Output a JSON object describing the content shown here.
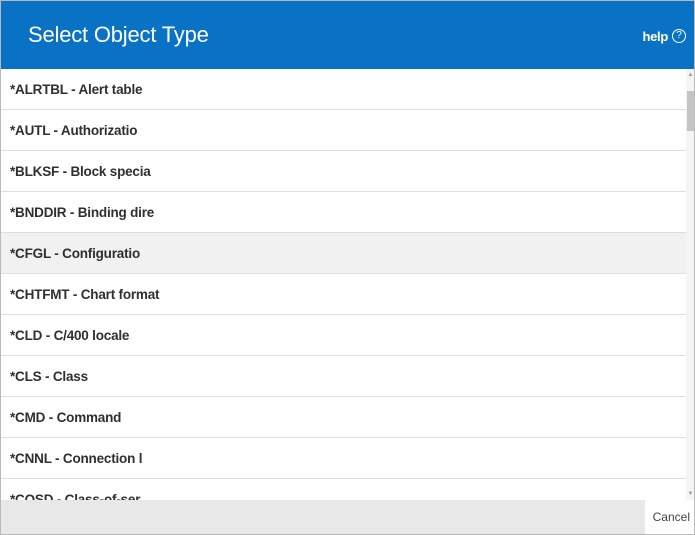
{
  "dialog": {
    "title": "Select Object Type",
    "help_label": "help",
    "help_icon": "question-circle-icon",
    "header_color": "#0a72c4"
  },
  "list": {
    "items": [
      {
        "label": "*ALRTBL - Alert table"
      },
      {
        "label": "*AUTL - Authorizatio"
      },
      {
        "label": "*BLKSF - Block specia"
      },
      {
        "label": "*BNDDIR - Binding dire"
      },
      {
        "label": "*CFGL - Configuratio",
        "hovered": true
      },
      {
        "label": "*CHTFMT - Chart format"
      },
      {
        "label": "*CLD - C/400 locale"
      },
      {
        "label": "*CLS - Class"
      },
      {
        "label": "*CMD - Command"
      },
      {
        "label": "*CNNL - Connection l"
      },
      {
        "label": "*COSD - Class-of-ser"
      }
    ]
  },
  "footer": {
    "cancel_label": "Cancel"
  }
}
